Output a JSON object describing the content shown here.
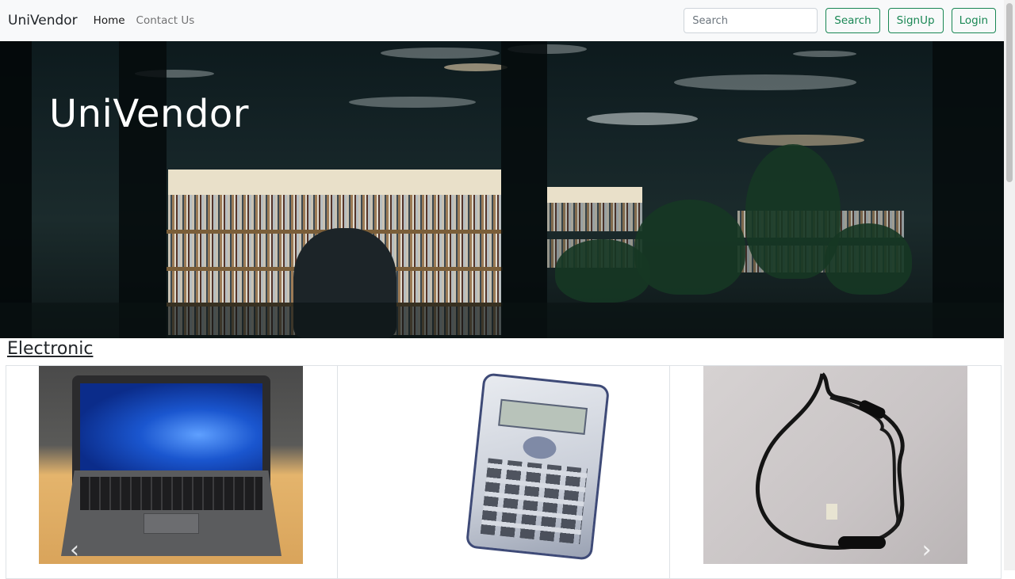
{
  "navbar": {
    "brand": "UniVendor",
    "links": [
      {
        "label": "Home",
        "active": true
      },
      {
        "label": "Contact Us",
        "active": false
      }
    ],
    "search": {
      "placeholder": "Search",
      "value": ""
    },
    "buttons": {
      "search": "Search",
      "signup": "SignUp",
      "login": "Login"
    }
  },
  "hero": {
    "title": "UniVendor",
    "image": "library-bookshelves-night"
  },
  "sections": [
    {
      "title": "Electronic",
      "products": [
        {
          "image": "laptop-photo"
        },
        {
          "image": "calculator-photo"
        },
        {
          "image": "earphones-photo"
        }
      ]
    }
  ],
  "carousel": {
    "prev_icon": "chevron-left-icon",
    "next_icon": "chevron-right-icon"
  },
  "colors": {
    "navbar_bg": "#f8f9fa",
    "accent_green": "#198754",
    "text_dark": "#212529"
  }
}
